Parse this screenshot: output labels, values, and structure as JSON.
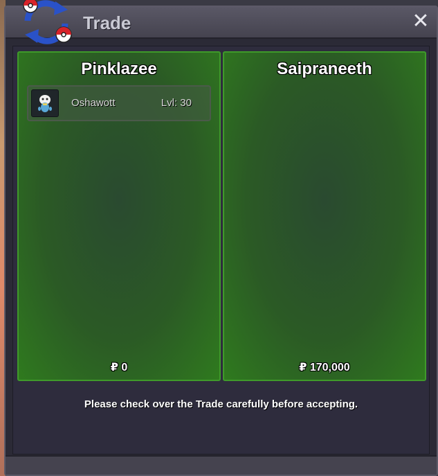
{
  "window": {
    "title": "Trade",
    "close_symbol": "✕"
  },
  "trade": {
    "left": {
      "name": "Pinklazee",
      "items": [
        {
          "name": "Oshawott",
          "level": "Lvl: 30"
        }
      ],
      "money": "₽ 0"
    },
    "right": {
      "name": "Saipraneeth",
      "items": [],
      "money": "₽ 170,000"
    }
  },
  "notice": "Please check over the Trade carefully before accepting.",
  "icons": {
    "logo": "trade-arrows-pokeball-icon",
    "close": "close-icon",
    "pokemon": "oshawott-sprite-icon"
  },
  "colors": {
    "panel_border": "#3f9a2a",
    "panel_fill": "#2b5a25",
    "titlebar": "#4f4d5a",
    "body": "#2e2c3d"
  }
}
